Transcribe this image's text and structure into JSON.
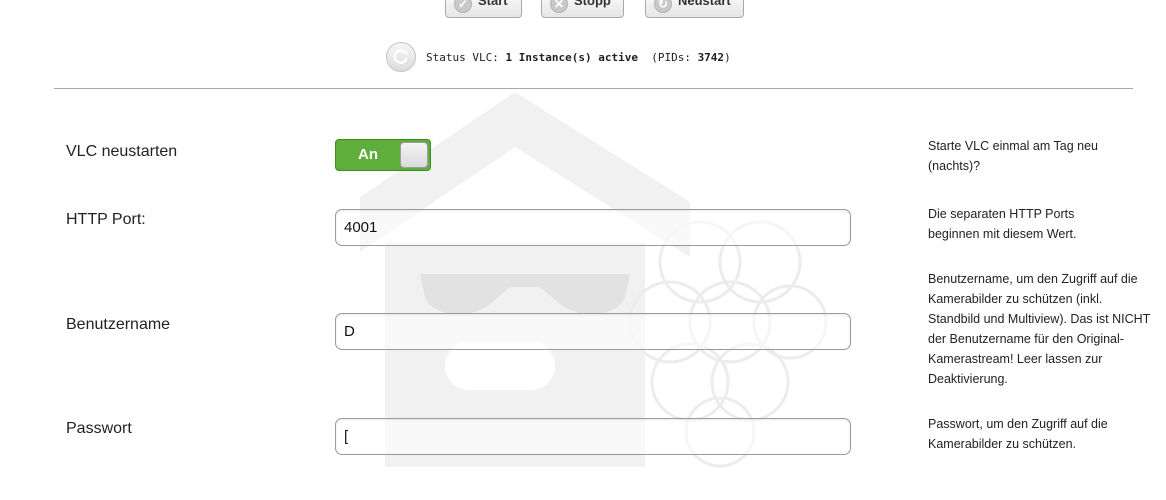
{
  "toolbar": {
    "start_label": "Start",
    "stop_label": "Stopp",
    "restart_label": "Neustart"
  },
  "status": {
    "prefix": "Status VLC: ",
    "count": "1",
    "active_text": "Instance(s) active",
    "pids_prefix": "(PIDs: ",
    "pids_value": "3742",
    "pids_suffix": ")"
  },
  "form": {
    "vlc_restart": {
      "label": "VLC neustarten",
      "toggle_text": "An",
      "toggle_on": true,
      "help": "Starte VLC einmal am Tag neu (nachts)?"
    },
    "http_port": {
      "label": "HTTP Port:",
      "value": "4001",
      "help": "Die separaten HTTP Ports beginnen mit diesem Wert."
    },
    "username": {
      "label": "Benutzername",
      "value": "D",
      "help": "Benutzername, um den Zugriff auf die Kamerabilder zu schützen (inkl. Standbild und Multiview). Das ist NICHT der Benutzername für den Original-Kamerastream! Leer lassen zur Deaktivierung."
    },
    "password": {
      "label": "Passwort",
      "value": "[",
      "help": "Passwort, um den Zugriff auf die Kamerabilder zu schützen."
    }
  },
  "colors": {
    "toggle_on": "#5fad3a",
    "watermark": "#f0f0f0",
    "divider": "#a8a8a8"
  }
}
